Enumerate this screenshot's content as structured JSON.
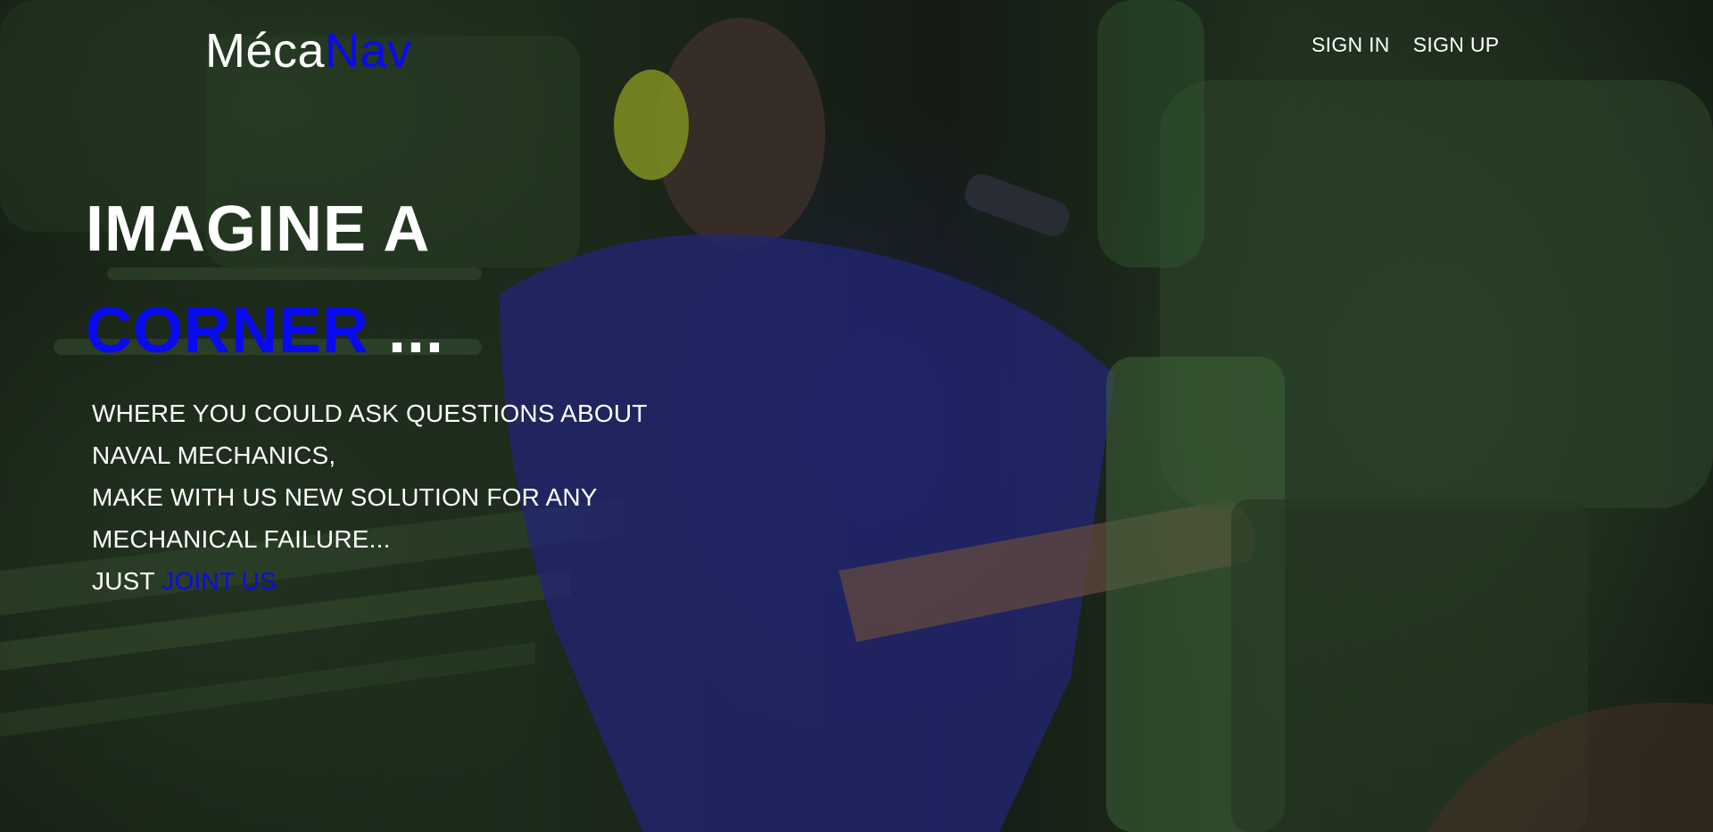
{
  "brand": {
    "part1": "Méca",
    "part2": "Nav",
    "accent_color": "#0a0af0"
  },
  "nav": {
    "sign_in": "SIGN IN",
    "sign_up": "SIGN UP"
  },
  "hero": {
    "headline_line1": "IMAGINE A",
    "headline_word": "CORNER",
    "headline_suffix": " ...",
    "tagline_lines": [
      "WHERE YOU COULD ASK QUESTIONS ABOUT",
      "NAVAL MECHANICS,",
      "MAKE WITH US NEW SOLUTION FOR ANY",
      "MECHANICAL FAILURE...",
      "JUST "
    ],
    "cta_link": "JOINT US"
  },
  "background": {
    "icon": "engine-room-photo"
  }
}
